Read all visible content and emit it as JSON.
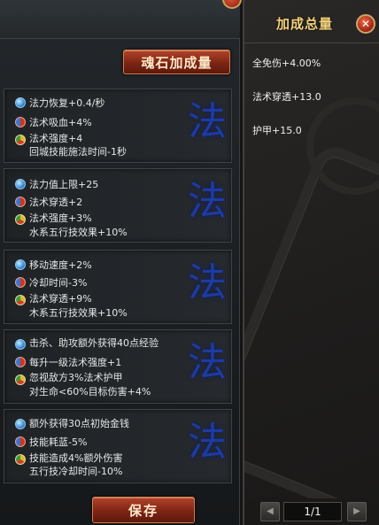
{
  "left": {
    "stone_button_label": "魂石加成量",
    "save_button_label": "保存",
    "rune_glyph": "法",
    "groups": [
      {
        "lines": [
          "法力恢复+0.4/秒",
          "法术吸血+4%",
          "法术强度+4",
          "回城技能施法时间-1秒"
        ]
      },
      {
        "lines": [
          "法力值上限+25",
          "法术穿透+2",
          "法术强度+3%",
          "水系五行技效果+10%"
        ]
      },
      {
        "lines": [
          "移动速度+2%",
          "冷却时间-3%",
          "法术穿透+9%",
          "木系五行技效果+10%"
        ]
      },
      {
        "lines": [
          "击杀、助攻额外获得40点经验",
          "每升一级法术强度+1",
          "忽视敌方3%法术护甲",
          "对生命<60%目标伤害+4%"
        ]
      },
      {
        "lines": [
          "额外获得30点初始金钱",
          "技能耗蓝-5%",
          "技能造成4%额外伤害",
          "五行技冷却时间-10%"
        ]
      }
    ]
  },
  "right": {
    "title": "加成总量",
    "close_icon": "✕",
    "stats": [
      "全免伤+4.00%",
      "法术穿透+13.0",
      "护甲+15.0"
    ],
    "pager": {
      "text": "1/1",
      "prev": "◀",
      "next": "▶"
    }
  }
}
